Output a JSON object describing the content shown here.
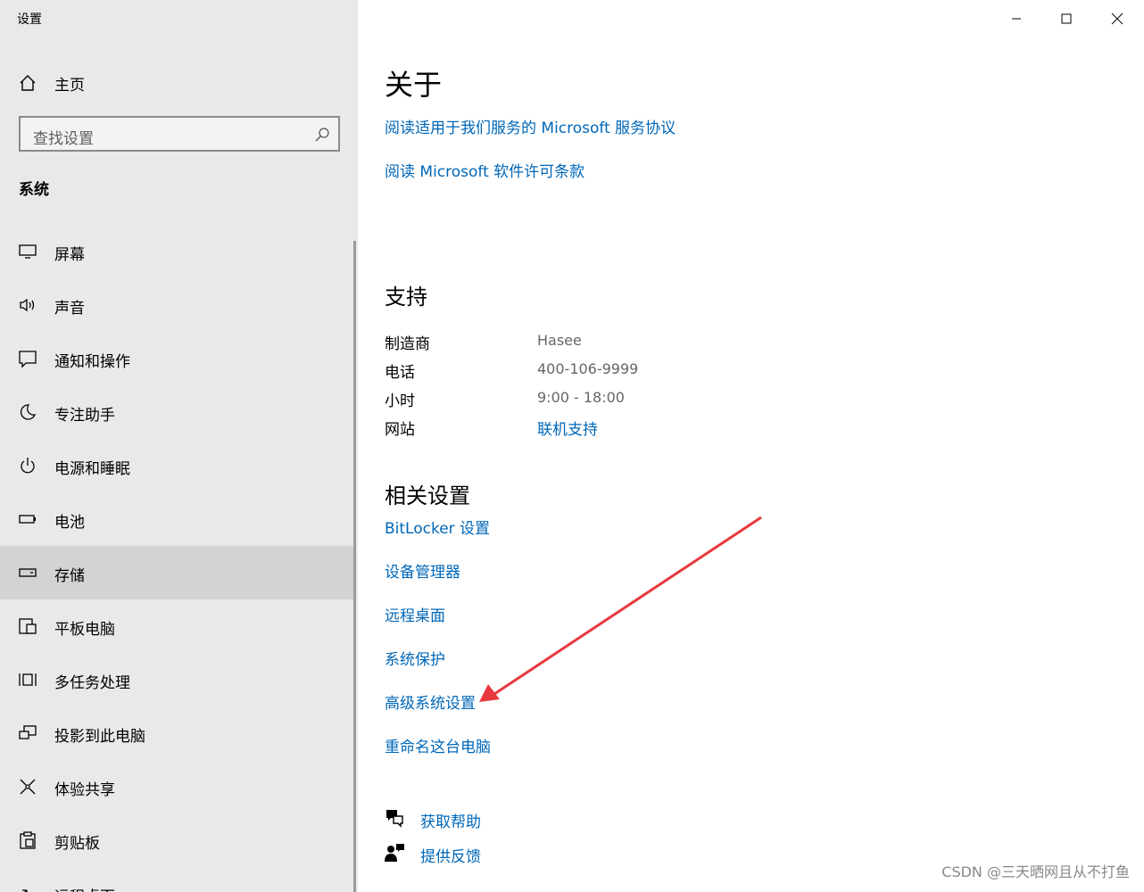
{
  "window": {
    "title": "设置"
  },
  "sidebar": {
    "home_label": "主页",
    "search_placeholder": "查找设置",
    "section_title": "系统",
    "items": [
      {
        "label": "屏幕",
        "icon": "monitor-icon"
      },
      {
        "label": "声音",
        "icon": "speaker-icon"
      },
      {
        "label": "通知和操作",
        "icon": "notification-icon"
      },
      {
        "label": "专注助手",
        "icon": "moon-icon"
      },
      {
        "label": "电源和睡眠",
        "icon": "power-icon"
      },
      {
        "label": "电池",
        "icon": "battery-icon"
      },
      {
        "label": "存储",
        "icon": "storage-icon",
        "selected": true
      },
      {
        "label": "平板电脑",
        "icon": "tablet-icon"
      },
      {
        "label": "多任务处理",
        "icon": "multitask-icon"
      },
      {
        "label": "投影到此电脑",
        "icon": "project-icon"
      },
      {
        "label": "体验共享",
        "icon": "share-icon"
      },
      {
        "label": "剪贴板",
        "icon": "clipboard-icon"
      },
      {
        "label": "远程桌面",
        "icon": "remote-icon"
      }
    ]
  },
  "main": {
    "about_title": "关于",
    "about_links": [
      "阅读适用于我们服务的 Microsoft 服务协议",
      "阅读 Microsoft 软件许可条款"
    ],
    "support_title": "支持",
    "support_rows": [
      {
        "label": "制造商",
        "value": "Hasee"
      },
      {
        "label": "电话",
        "value": "400-106-9999"
      },
      {
        "label": "小时",
        "value": "9:00 - 18:00"
      },
      {
        "label": "网站",
        "value": "联机支持"
      }
    ],
    "related_title": "相关设置",
    "related_links": [
      "BitLocker 设置",
      "设备管理器",
      "远程桌面",
      "系统保护",
      "高级系统设置",
      "重命名这台电脑"
    ],
    "footer": {
      "help_label": "获取帮助",
      "feedback_label": "提供反馈"
    }
  },
  "watermark": "CSDN @三天晒网且从不打鱼",
  "colors": {
    "accent": "#0067b8",
    "sidebar_bg": "#e9e9e9",
    "selected_bg": "#d3d3d3",
    "annotation": "#e8383d"
  }
}
